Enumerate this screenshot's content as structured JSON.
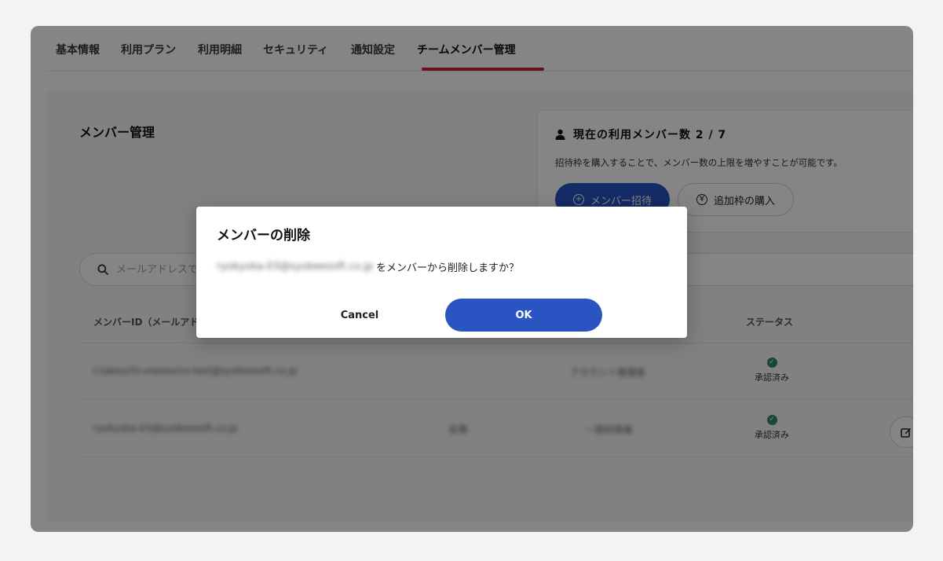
{
  "tabs": [
    {
      "label": "基本情報"
    },
    {
      "label": "利用プラン"
    },
    {
      "label": "利用明細"
    },
    {
      "label": "セキュリティ"
    },
    {
      "label": "通知設定"
    },
    {
      "label": "チームメンバー管理",
      "active": true
    }
  ],
  "page": {
    "title": "メンバー管理"
  },
  "info": {
    "title": "現在の利用メンバー数 2 / 7",
    "description": "招待枠を購入することで、メンバー数の上限を増やすことが可能です。",
    "invite_button": "メンバー招待",
    "purchase_button": "追加枠の購入"
  },
  "search": {
    "placeholder": "メールアドレスで検索"
  },
  "table": {
    "columns": [
      "メンバーID（メールアドレス）",
      "ステータス"
    ],
    "rows": [
      {
        "email": "t.takeuchi-vresource-test@syobeesoft.co.jp",
        "role": "",
        "type": "アカウント管理者",
        "status": "承認済み"
      },
      {
        "email": "ryokyoka-03@syobeesoft.co.jp",
        "role": "名簿",
        "type": "一般利用者",
        "status": "承認済み"
      }
    ]
  },
  "dialog": {
    "title": "メンバーの削除",
    "email": "ryokyoka-03@syobeesoft.co.jp",
    "message": "をメンバーから削除しますか？",
    "cancel": "Cancel",
    "ok": "OK"
  },
  "colors": {
    "accent": "#2a54c2",
    "tab_underline": "#c8202a",
    "status_ok": "#2f8a68"
  }
}
